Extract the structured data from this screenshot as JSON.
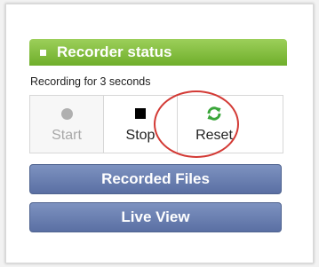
{
  "recorder": {
    "header_title": "Recorder status",
    "status_text": "Recording for 3 seconds",
    "controls": {
      "start": {
        "label": "Start",
        "icon": "record-dot-icon",
        "enabled": false
      },
      "stop": {
        "label": "Stop",
        "icon": "stop-square-icon",
        "enabled": true
      },
      "reset": {
        "label": "Reset",
        "icon": "refresh-icon",
        "enabled": true
      }
    }
  },
  "nav": {
    "recorded_files_label": "Recorded Files",
    "live_view_label": "Live View"
  },
  "colors": {
    "header_green": "#7fbd3b",
    "button_blue": "#6a7fb2",
    "highlight_red": "#d33a35",
    "reset_icon_green": "#3aa63a"
  }
}
